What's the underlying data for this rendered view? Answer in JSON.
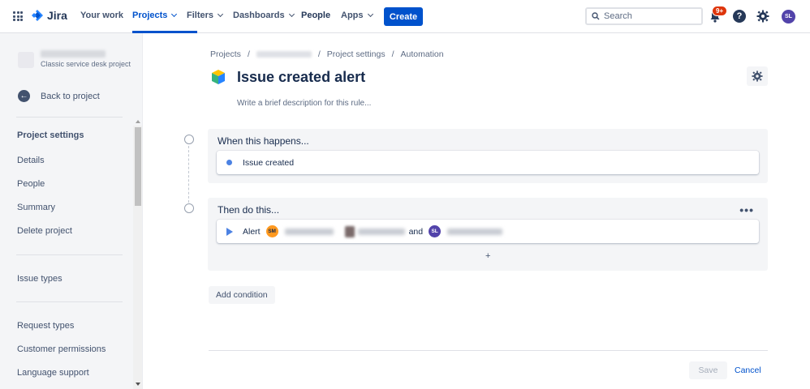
{
  "topnav": {
    "logo": "Jira",
    "items": [
      {
        "label": "Your work"
      },
      {
        "label": "Projects"
      },
      {
        "label": "Filters"
      },
      {
        "label": "Dashboards"
      },
      {
        "label": "People"
      },
      {
        "label": "Apps"
      }
    ],
    "create": "Create",
    "search_placeholder": "Search",
    "notifications_badge": "9+",
    "help": "?",
    "user_initials": "SL",
    "accent": "#0052cc"
  },
  "sidebar": {
    "project_type": "Classic service desk project",
    "back": "Back to project",
    "heading": "Project settings",
    "items": [
      {
        "label": "Details"
      },
      {
        "label": "People"
      },
      {
        "label": "Summary"
      },
      {
        "label": "Delete project"
      },
      {
        "label": "Issue types"
      },
      {
        "label": "Request types"
      },
      {
        "label": "Customer permissions"
      },
      {
        "label": "Language support"
      }
    ]
  },
  "main": {
    "breadcrumb": {
      "projects": "Projects",
      "sep": "/",
      "settings": "Project settings",
      "automation": "Automation"
    },
    "title": "Issue created alert",
    "description_placeholder": "Write a brief description for this rule...",
    "trigger": {
      "heading": "When this happens...",
      "item": "Issue created"
    },
    "action": {
      "heading": "Then do this...",
      "verb": "Alert",
      "recipient1_initials": "SM",
      "conjunction": "and",
      "recipient2_initials": "SL",
      "more": "•••",
      "add": "+"
    },
    "add_condition": "Add condition",
    "save": "Save",
    "cancel": "Cancel"
  }
}
